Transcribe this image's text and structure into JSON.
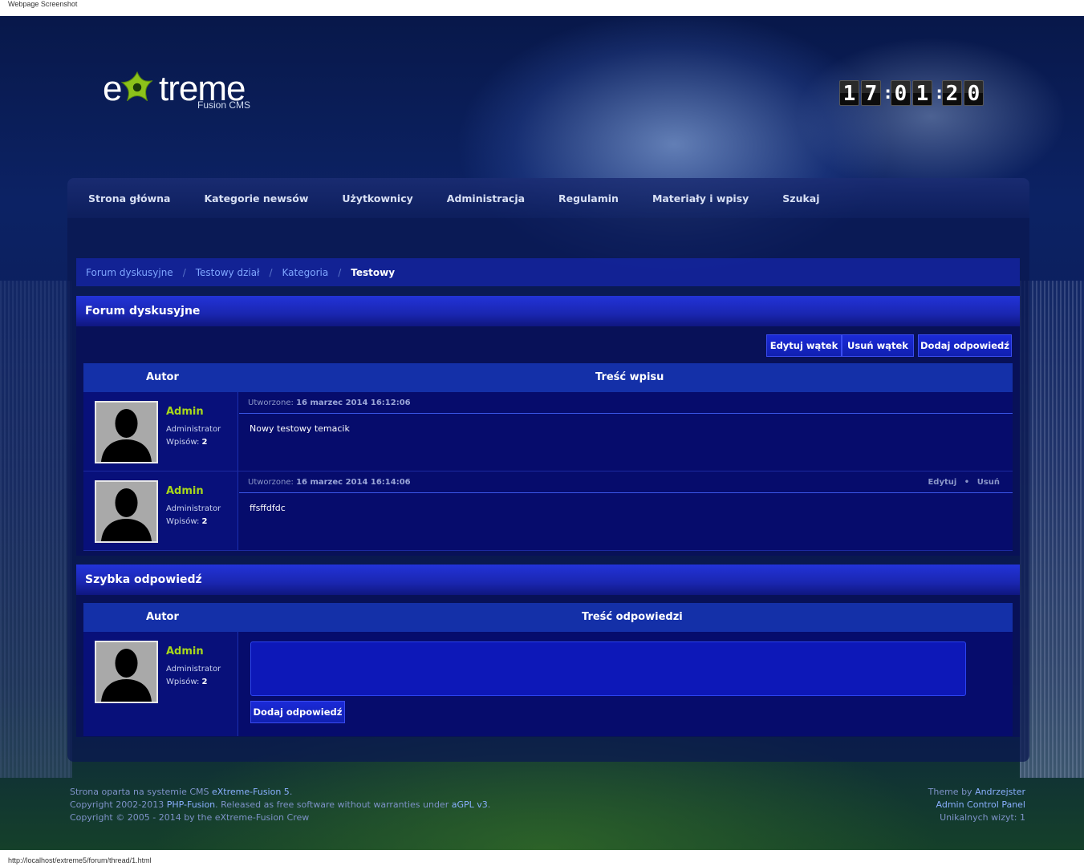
{
  "screenshot_label": "Webpage Screenshot",
  "status_url": "http://localhost/extreme5/forum/thread/1.html",
  "logo": {
    "e": "e",
    "treme": "treme",
    "sub": "Fusion CMS"
  },
  "clock": {
    "h1": "1",
    "h2": "7",
    "m1": "0",
    "m2": "1",
    "s1": "2",
    "s2": "0"
  },
  "nav": [
    "Strona główna",
    "Kategorie newsów",
    "Użytkownicy",
    "Administracja",
    "Regulamin",
    "Materiały i wpisy",
    "Szukaj"
  ],
  "breadcrumb": {
    "items": [
      "Forum dyskusyjne",
      "Testowy dział",
      "Kategoria"
    ],
    "current": "Testowy",
    "separator": "/"
  },
  "forum": {
    "title": "Forum dyskusyjne",
    "buttons": {
      "edit": "Edytuj wątek",
      "delete": "Usuń wątek",
      "reply": "Dodaj odpowiedź"
    },
    "headers": {
      "author": "Autor",
      "content": "Treść wpisu"
    },
    "posts": [
      {
        "name": "Admin",
        "role": "Administrator",
        "posts_label": "Wpisów:",
        "posts_count": "2",
        "created_label": "Utworzone:",
        "created": "16 marzec 2014 16:12:06",
        "body": "Nowy testowy temacik",
        "edit": "",
        "sep": "",
        "delete": ""
      },
      {
        "name": "Admin",
        "role": "Administrator",
        "posts_label": "Wpisów:",
        "posts_count": "2",
        "created_label": "Utworzone:",
        "created": "16 marzec 2014 16:14:06",
        "body": "ffsffdfdc",
        "edit": "Edytuj",
        "sep": "•",
        "delete": "Usuń"
      }
    ]
  },
  "quick_reply": {
    "title": "Szybka odpowiedź",
    "headers": {
      "author": "Autor",
      "content": "Treść odpowiedzi"
    },
    "user": {
      "name": "Admin",
      "role": "Administrator",
      "posts_label": "Wpisów:",
      "posts_count": "2"
    },
    "textarea_value": "",
    "submit": "Dodaj odpowiedź"
  },
  "footer": {
    "line1_prefix": "Strona oparta na systemie CMS ",
    "line1_link": "eXtreme-Fusion 5",
    "line1_suffix": ".",
    "line2_prefix": "Copyright 2002-2013 ",
    "line2_link": "PHP-Fusion",
    "line2_mid": ". Released as free software without warranties under ",
    "line2_link2": "aGPL v3",
    "line2_suffix": ".",
    "line3": "Copyright © 2005 - 2014 by the eXtreme-Fusion Crew",
    "theme_prefix": "Theme by ",
    "theme_link": "Andrzejster",
    "acp": "Admin Control Panel",
    "visits_label": "Unikalnych wizyt:",
    "visits": "1"
  },
  "colors": {
    "accent": "#1a26b0",
    "username": "#a8d81a",
    "link": "#7fa6ff"
  }
}
